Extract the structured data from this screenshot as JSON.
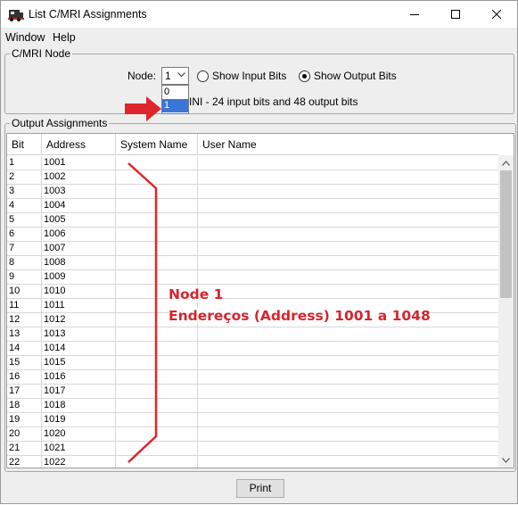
{
  "window": {
    "title": "List C/MRI Assignments"
  },
  "menu": [
    "Window",
    "Help"
  ],
  "node_group": {
    "title": "C/MRI Node",
    "node_label": "Node:",
    "node_value": "1",
    "dropdown_options": [
      "0",
      "1"
    ],
    "radio_input_label": "Show Input Bits",
    "radio_output_label": "Show Output Bits",
    "selected_radio": "output",
    "info_text": "INI - 24 input bits and 48 output bits"
  },
  "output_group": {
    "title": "Output Assignments",
    "columns": [
      "Bit",
      "Address",
      "System Name",
      "User Name"
    ],
    "rows": [
      [
        "1",
        "1001"
      ],
      [
        "2",
        "1002"
      ],
      [
        "3",
        "1003"
      ],
      [
        "4",
        "1004"
      ],
      [
        "5",
        "1005"
      ],
      [
        "6",
        "1006"
      ],
      [
        "7",
        "1007"
      ],
      [
        "8",
        "1008"
      ],
      [
        "9",
        "1009"
      ],
      [
        "10",
        "1010"
      ],
      [
        "11",
        "1011"
      ],
      [
        "12",
        "1012"
      ],
      [
        "13",
        "1013"
      ],
      [
        "14",
        "1014"
      ],
      [
        "15",
        "1015"
      ],
      [
        "16",
        "1016"
      ],
      [
        "17",
        "1017"
      ],
      [
        "18",
        "1018"
      ],
      [
        "19",
        "1019"
      ],
      [
        "20",
        "1020"
      ],
      [
        "21",
        "1021"
      ],
      [
        "22",
        "1022"
      ]
    ]
  },
  "print_label": "Print",
  "annotation": {
    "line1": "Node 1",
    "line2": "Endereços (Address) 1001 a 1048",
    "color": "#d8242c"
  },
  "colors": {
    "selection": "#3a76d8",
    "window_bg": "#eeeeee"
  }
}
